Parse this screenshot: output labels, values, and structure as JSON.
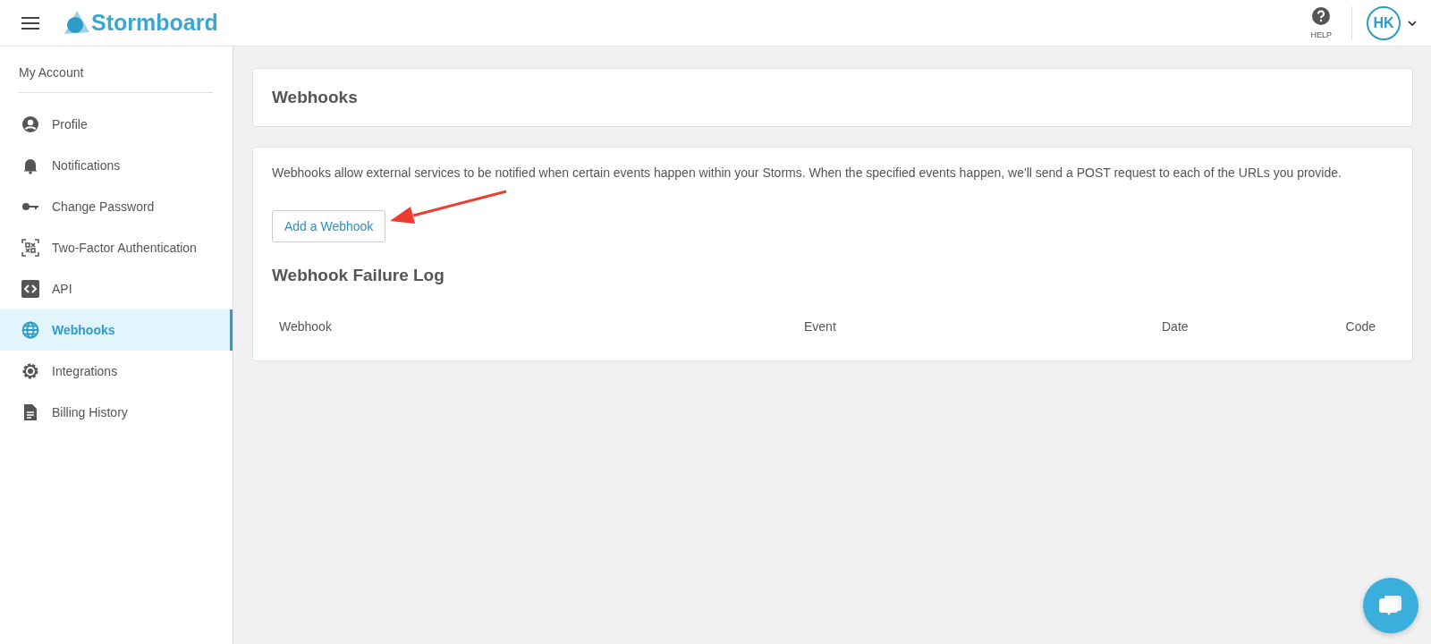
{
  "header": {
    "logo": "Stormboard",
    "help_label": "HELP",
    "avatar_initials": "HK"
  },
  "sidebar": {
    "title": "My Account",
    "items": [
      {
        "label": "Profile",
        "kind": "profile",
        "selected": false
      },
      {
        "label": "Notifications",
        "kind": "bell",
        "selected": false
      },
      {
        "label": "Change Password",
        "kind": "key",
        "selected": false
      },
      {
        "label": "Two-Factor Authentication",
        "kind": "qr",
        "selected": false
      },
      {
        "label": "API",
        "kind": "code",
        "selected": false
      },
      {
        "label": "Webhooks",
        "kind": "globe",
        "selected": true
      },
      {
        "label": "Integrations",
        "kind": "gear",
        "selected": false
      },
      {
        "label": "Billing History",
        "kind": "document",
        "selected": false
      }
    ]
  },
  "page_title": "Webhooks",
  "description": "Webhooks allow external services to be notified when certain events happen within your Storms. When the specified events happen, we'll send a POST request to each of the URLs you provide.",
  "add_button": "Add a Webhook",
  "failure_log": {
    "title": "Webhook Failure Log",
    "columns": [
      "Webhook",
      "Event",
      "Date",
      "Code"
    ]
  }
}
